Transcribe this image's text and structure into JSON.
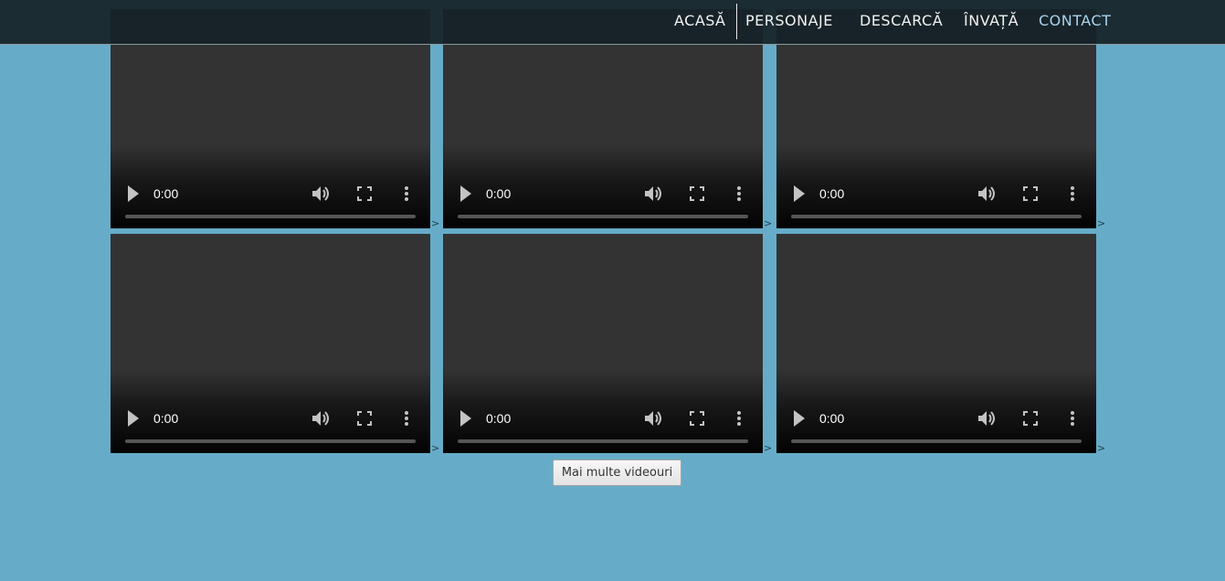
{
  "nav": {
    "items": [
      {
        "label": "ACASĂ"
      },
      {
        "label": "PERSONAJE"
      },
      {
        "label": "DESCARCĂ"
      },
      {
        "label": "ÎNVAȚĂ"
      },
      {
        "label": "CONTACT"
      }
    ]
  },
  "videos": [
    {
      "time": "0:00",
      "progress": 0
    },
    {
      "time": "0:00",
      "progress": 0
    },
    {
      "time": "0:00",
      "progress": 0
    },
    {
      "time": "0:00",
      "progress": 0
    },
    {
      "time": "0:00",
      "progress": 0
    },
    {
      "time": "0:00",
      "progress": 0
    }
  ],
  "tile_suffix": ">",
  "more_button": {
    "label": "Mai multe videouri"
  },
  "colors": {
    "page_background": "#66acc8",
    "navbar": "#162228",
    "nav_active": "#a9d3ee",
    "video_background": "#333333"
  },
  "icons": {
    "play": "play-icon",
    "volume": "volume-icon",
    "fullscreen": "fullscreen-icon",
    "menu": "more-vert-icon"
  }
}
